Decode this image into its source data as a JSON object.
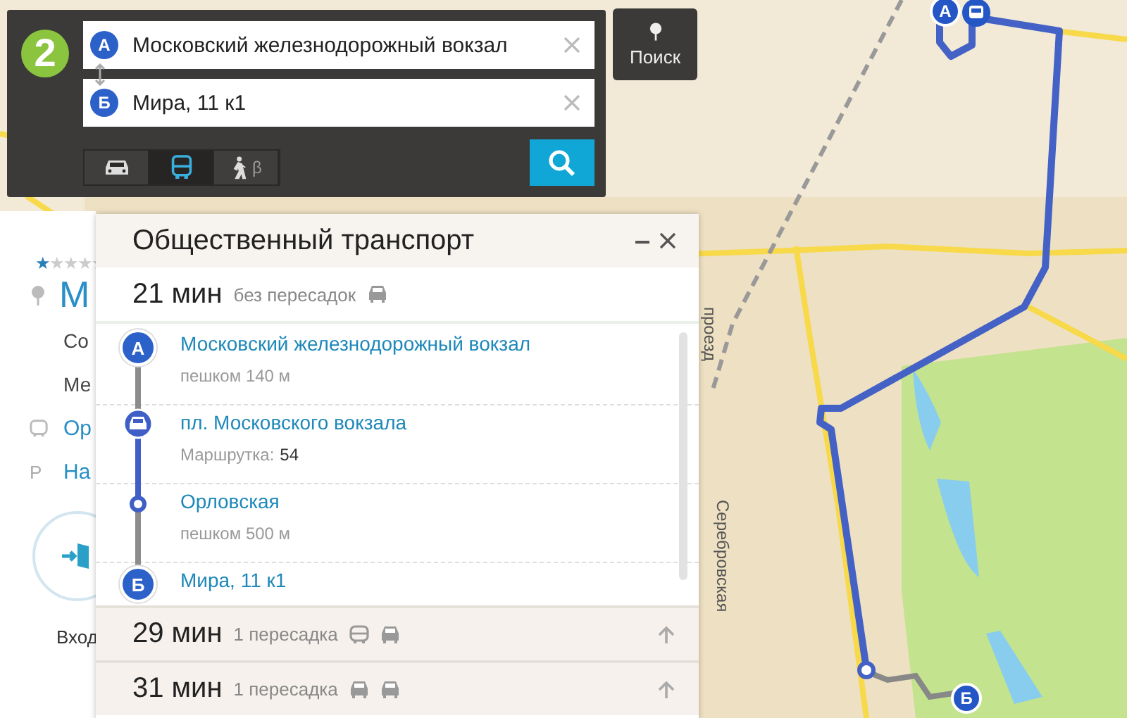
{
  "logo": {
    "text": "2"
  },
  "route_form": {
    "from": {
      "marker": "А",
      "value": "Московский железнодорожный вокзал"
    },
    "to": {
      "marker": "Б",
      "value": "Мира, 11 к1"
    },
    "modes": [
      {
        "kind": "car",
        "selected": false
      },
      {
        "kind": "bus",
        "selected": true
      },
      {
        "kind": "walk",
        "selected": false,
        "badge": "β"
      }
    ]
  },
  "search_button": {
    "label": "Поиск"
  },
  "place_card": {
    "stars": 1,
    "title": "М",
    "lines": [
      {
        "kind": "text",
        "text": "Со"
      },
      {
        "kind": "text",
        "text": "Ме"
      },
      {
        "kind": "bus",
        "text": "Ор"
      },
      {
        "kind": "parking",
        "icon": "P",
        "text": "На"
      }
    ],
    "entrance_label": "Вход"
  },
  "transport_panel": {
    "title": "Общественный транспорт",
    "routes": [
      {
        "time": "21 мин",
        "transfers": "без пересадок",
        "vehicles": [
          {
            "kind": "minibus"
          }
        ],
        "expanded": true,
        "steps": [
          {
            "kind": "start",
            "marker": "А",
            "name": "Московский железнодорожный вокзал",
            "detail": "пешком 140 м"
          },
          {
            "kind": "board",
            "name": "пл. Московского вокзала",
            "detail": "Маршрутка:",
            "value": "54"
          },
          {
            "kind": "stop",
            "name": "Орловская",
            "detail": "пешком 500 м"
          },
          {
            "kind": "end",
            "marker": "Б",
            "name": "Мира, 11 к1"
          }
        ]
      },
      {
        "time": "29 мин",
        "transfers": "1 пересадка",
        "vehicles": [
          {
            "kind": "bus"
          },
          {
            "kind": "minibus"
          }
        ],
        "expanded": false
      },
      {
        "time": "31 мин",
        "transfers": "1 пересадка",
        "vehicles": [
          {
            "kind": "minibus"
          },
          {
            "kind": "minibus"
          }
        ],
        "expanded": false
      }
    ]
  },
  "map": {
    "start_marker": "А",
    "end_marker": "Б",
    "street_labels": [
      "Серебровская",
      "проезд"
    ]
  }
}
